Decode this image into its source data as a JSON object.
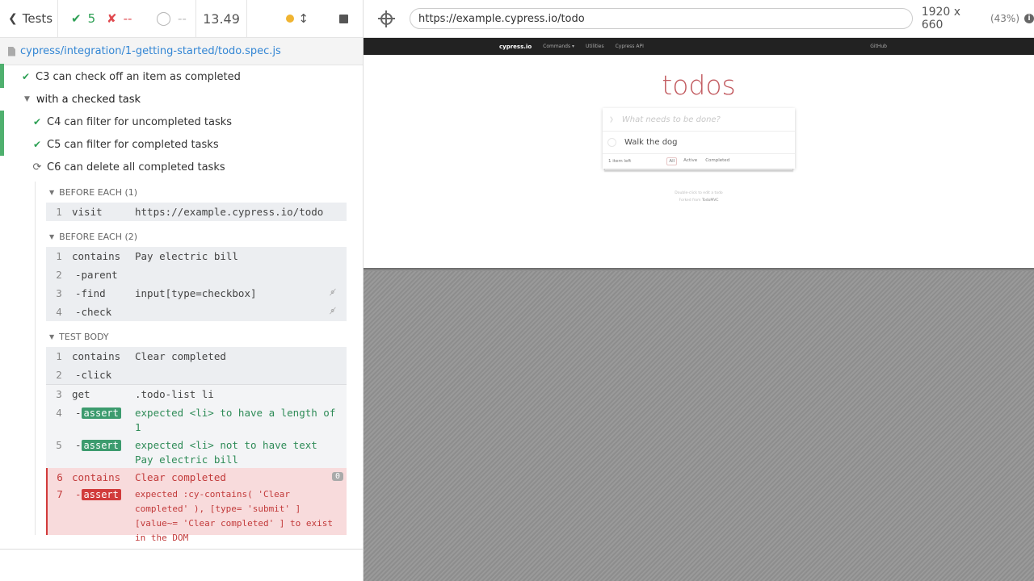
{
  "stats": {
    "tests_label": "Tests",
    "passed": "5",
    "failed": "--",
    "pending": "--",
    "duration": "13.49"
  },
  "spec": {
    "path": "cypress/integration/1-getting-started/todo.spec.js"
  },
  "tests": {
    "c3": "C3 can check off an item as completed",
    "suite": "with a checked task",
    "c4": "C4 can filter for uncompleted tasks",
    "c5": "C5 can filter for completed tasks",
    "c6": "C6 can delete all completed tasks"
  },
  "hooks": {
    "before_each_1": {
      "title": "BEFORE EACH (1)",
      "commands": [
        {
          "num": "1",
          "name": "visit",
          "message": "https://example.cypress.io/todo"
        }
      ]
    },
    "before_each_2": {
      "title": "BEFORE EACH (2)",
      "commands": [
        {
          "num": "1",
          "name": "contains",
          "message": "Pay electric bill"
        },
        {
          "num": "2",
          "name": "-parent",
          "message": ""
        },
        {
          "num": "3",
          "name": "-find",
          "message": "input[type=checkbox]"
        },
        {
          "num": "4",
          "name": "-check",
          "message": ""
        }
      ]
    },
    "test_body": {
      "title": "TEST BODY",
      "commands": [
        {
          "num": "1",
          "name": "contains",
          "message": "Clear completed"
        },
        {
          "num": "2",
          "name": "-click",
          "message": ""
        },
        {
          "num": "3",
          "name": "get",
          "message": ".todo-list li"
        },
        {
          "num": "4",
          "name": "-",
          "badge": "assert",
          "message": "expected  <li>  to have a length of 1"
        },
        {
          "num": "5",
          "name": "-",
          "badge": "assert",
          "message": "expected  <li>  not to have text  Pay electric bill"
        },
        {
          "num": "6",
          "name": "contains",
          "message": "Clear completed",
          "count": "0"
        },
        {
          "num": "7",
          "name": "-",
          "badge": "assert",
          "message": "expected  :cy-contains( 'Clear completed' ), [type= 'submit' ] [value~= 'Clear completed' ]  to exist in the DOM"
        }
      ]
    }
  },
  "aut": {
    "url": "https://example.cypress.io/todo",
    "viewport": "1920 x 660",
    "scale": "(43%)",
    "nav": {
      "brand": "cypress.io",
      "items": [
        "Commands ▾",
        "Utilities",
        "Cypress API"
      ],
      "github": "GitHub"
    },
    "title": "todos",
    "placeholder": "What needs to be done?",
    "todo_item": "Walk the dog",
    "items_left": "1 item left",
    "filters": [
      "All",
      "Active",
      "Completed"
    ],
    "info_line1": "Double-click to edit a todo",
    "info_line2_prefix": "Forked from ",
    "info_line2_link": "TodoMVC"
  }
}
